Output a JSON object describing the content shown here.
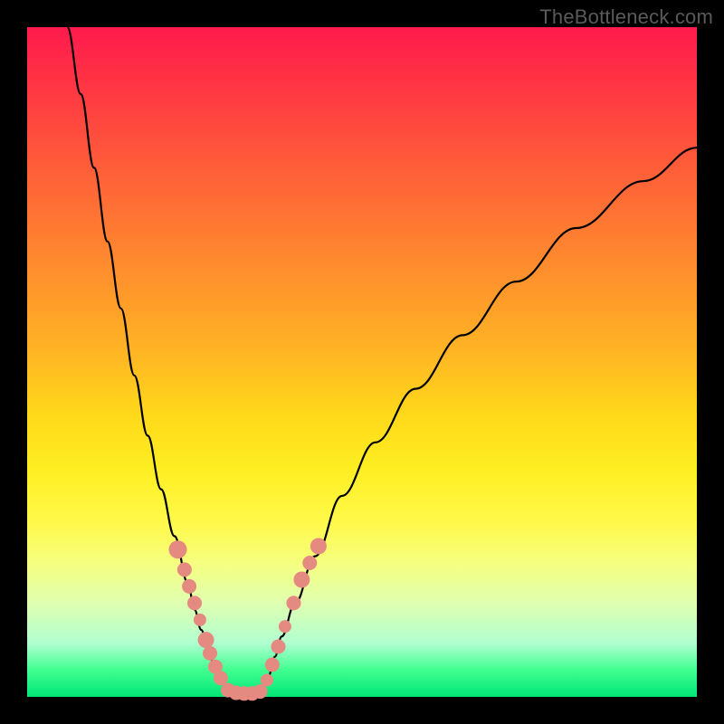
{
  "watermark_text": "TheBottleneck.com",
  "chart_data": {
    "type": "line",
    "title": "",
    "xlabel": "",
    "ylabel": "",
    "xlim": [
      0,
      100
    ],
    "ylim": [
      0,
      100
    ],
    "curves": [
      {
        "name": "left-branch",
        "x": [
          6,
          8,
          10,
          12,
          14,
          16,
          18,
          20,
          22,
          24,
          25,
          26,
          27,
          28,
          29,
          30
        ],
        "y": [
          100,
          90,
          79,
          68,
          58,
          48,
          39,
          31,
          24,
          17,
          13,
          10,
          7,
          4.5,
          2.5,
          1
        ]
      },
      {
        "name": "right-branch",
        "x": [
          35,
          36,
          37,
          38,
          40,
          43,
          47,
          52,
          58,
          65,
          73,
          82,
          92,
          100
        ],
        "y": [
          1,
          3,
          6,
          9,
          14,
          21,
          30,
          38,
          46,
          54,
          62,
          70,
          77,
          82
        ]
      },
      {
        "name": "bottom-flat",
        "x": [
          30,
          31,
          32,
          33,
          34,
          35
        ],
        "y": [
          1,
          0.6,
          0.4,
          0.4,
          0.6,
          1
        ]
      }
    ],
    "markers": {
      "left_cluster": [
        {
          "x": 22.5,
          "y": 22,
          "r": 10
        },
        {
          "x": 23.5,
          "y": 19,
          "r": 8
        },
        {
          "x": 24.2,
          "y": 16.5,
          "r": 8
        },
        {
          "x": 25.0,
          "y": 14,
          "r": 8
        },
        {
          "x": 25.8,
          "y": 11.5,
          "r": 7
        },
        {
          "x": 26.7,
          "y": 8.5,
          "r": 9
        },
        {
          "x": 27.3,
          "y": 6.5,
          "r": 8
        },
        {
          "x": 28.1,
          "y": 4.5,
          "r": 8
        },
        {
          "x": 28.9,
          "y": 2.8,
          "r": 8
        }
      ],
      "right_cluster": [
        {
          "x": 35.8,
          "y": 2.5,
          "r": 7
        },
        {
          "x": 36.6,
          "y": 4.8,
          "r": 8
        },
        {
          "x": 37.5,
          "y": 7.5,
          "r": 8
        },
        {
          "x": 38.5,
          "y": 10.5,
          "r": 7
        },
        {
          "x": 39.8,
          "y": 14,
          "r": 8
        },
        {
          "x": 41.0,
          "y": 17.5,
          "r": 9
        },
        {
          "x": 42.2,
          "y": 20,
          "r": 8
        },
        {
          "x": 43.5,
          "y": 22.5,
          "r": 9
        }
      ],
      "bottom_cluster": [
        {
          "x": 30.0,
          "y": 1.0,
          "r": 8
        },
        {
          "x": 31.2,
          "y": 0.6,
          "r": 8
        },
        {
          "x": 32.4,
          "y": 0.5,
          "r": 8
        },
        {
          "x": 33.6,
          "y": 0.5,
          "r": 8
        },
        {
          "x": 34.8,
          "y": 0.8,
          "r": 8
        }
      ]
    },
    "colors": {
      "curve": "#000000",
      "marker": "#e58a80",
      "frame_bg": "#000000",
      "gradient_top": "#ff1a4d",
      "gradient_bottom": "#00e676"
    }
  }
}
